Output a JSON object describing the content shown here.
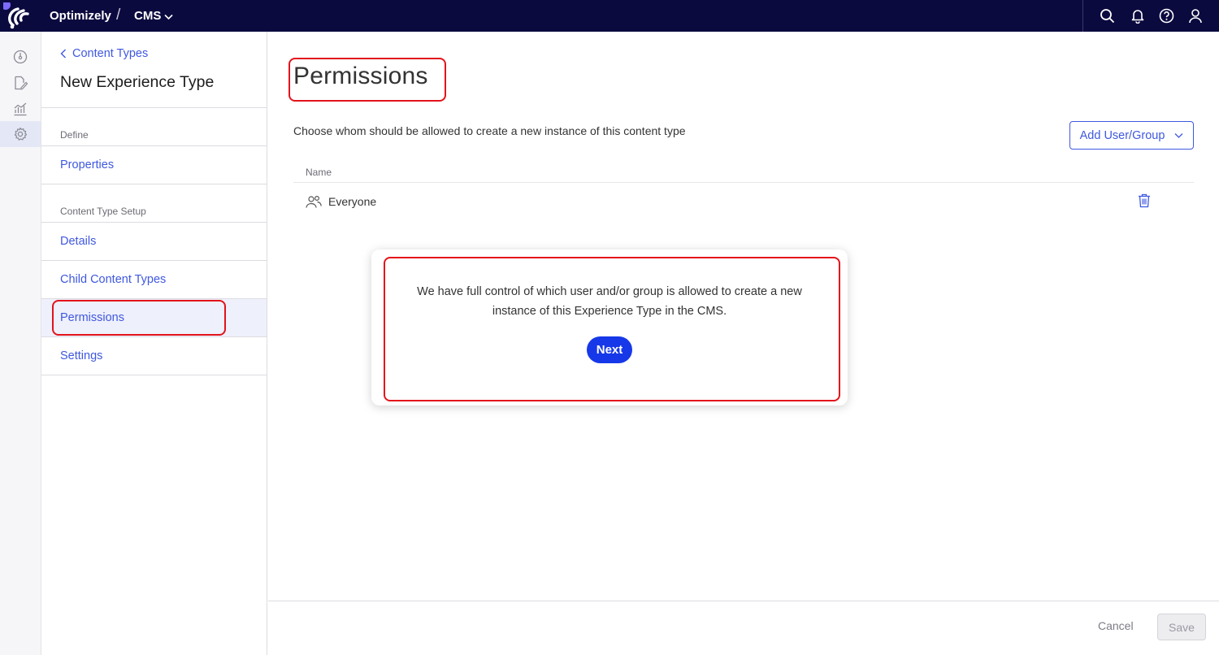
{
  "topbar": {
    "brand": "Optimizely",
    "separator": "/",
    "product": "CMS",
    "icons": [
      "search-icon",
      "bell-icon",
      "help-icon",
      "user-icon"
    ]
  },
  "rail": {
    "items": [
      "dashboard-icon",
      "edit-icon",
      "analytics-icon",
      "settings-icon"
    ],
    "active": "settings-icon"
  },
  "sidebar": {
    "back_label": "Content Types",
    "title": "New Experience Type",
    "section_define": "Define",
    "properties": "Properties",
    "section_setup": "Content Type Setup",
    "details": "Details",
    "child_types": "Child Content Types",
    "permissions": "Permissions",
    "settings": "Settings"
  },
  "main": {
    "title": "Permissions",
    "description": "Choose whom should be allowed to create a new instance of this content type",
    "add_button": "Add User/Group",
    "table": {
      "column_name": "Name",
      "rows": [
        {
          "name": "Everyone",
          "icon": "group-icon"
        }
      ]
    },
    "footer": {
      "cancel": "Cancel",
      "save": "Save"
    }
  },
  "tooltip": {
    "text": "We have full control of which user and/or group is allowed to create a new instance of this Experience Type in the CMS.",
    "next": "Next"
  },
  "colors": {
    "topbar": "#0b0a3f",
    "link": "#3f58e0",
    "highlight": "#e3131b",
    "next": "#1638e8"
  }
}
